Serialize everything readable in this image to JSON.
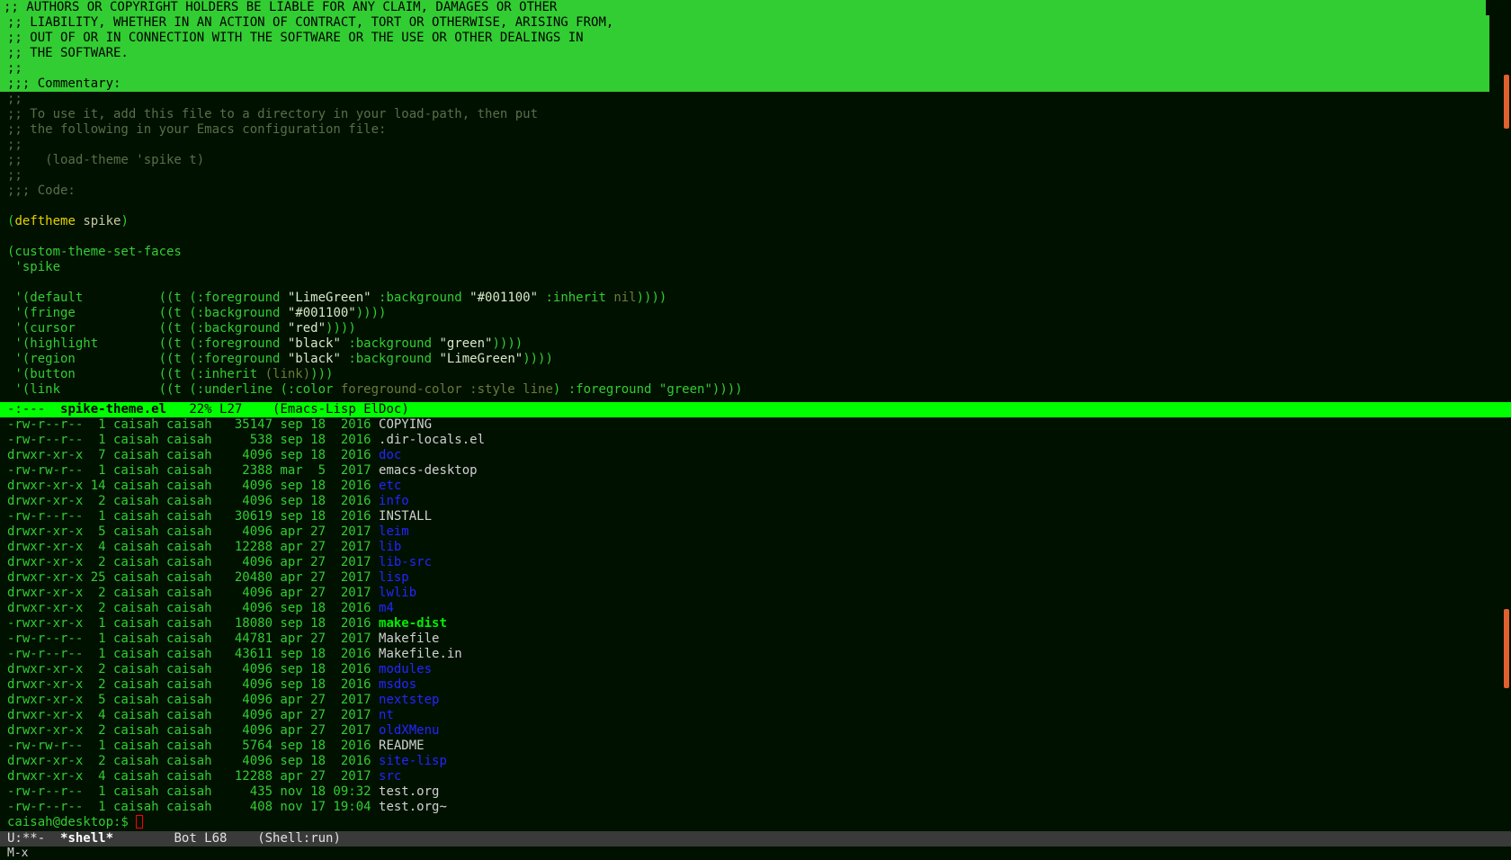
{
  "editor": {
    "highlighted_lines": [
      ";; AUTHORS OR COPYRIGHT HOLDERS BE LIABLE FOR ANY CLAIM, DAMAGES OR OTHER",
      ";; LIABILITY, WHETHER IN AN ACTION OF CONTRACT, TORT OR OTHERWISE, ARISING FROM,",
      ";; OUT OF OR IN CONNECTION WITH THE SOFTWARE OR THE USE OR OTHER DEALINGS IN",
      ";; THE SOFTWARE.",
      ";;",
      ";;; Commentary:"
    ],
    "comment_lines": [
      ";;",
      ";; To use it, add this file to a directory in your load-path, then put",
      ";; the following in your Emacs configuration file:",
      ";;",
      ";;   (load-theme 'spike t)",
      ";;",
      ";;; Code:"
    ],
    "deftheme": {
      "open": "(",
      "keyword": "deftheme",
      "name": "spike",
      "close": ")"
    },
    "custom_faces": "(custom-theme-set-faces",
    "theme_quote": " 'spike",
    "face_lines": [
      {
        "face": " '(default          ",
        "spec_pre": "((t (:foreground ",
        "s1": "\"LimeGreen\"",
        "mid": " :background ",
        "s2": "\"#001100\"",
        "tail_pre": " :inherit ",
        "tail_dim": "nil",
        "end": "))))"
      },
      {
        "face": " '(fringe           ",
        "spec_pre": "((t (:background ",
        "s1": "\"#001100\"",
        "mid": "",
        "s2": "",
        "tail_pre": "",
        "tail_dim": "",
        "end": "))))"
      },
      {
        "face": " '(cursor           ",
        "spec_pre": "((t (:background ",
        "s1": "\"red\"",
        "mid": "",
        "s2": "",
        "tail_pre": "",
        "tail_dim": "",
        "end": "))))"
      },
      {
        "face": " '(highlight        ",
        "spec_pre": "((t (:foreground ",
        "s1": "\"black\"",
        "mid": " :background ",
        "s2": "\"green\"",
        "tail_pre": "",
        "tail_dim": "",
        "end": "))))"
      },
      {
        "face": " '(region           ",
        "spec_pre": "((t (:foreground ",
        "s1": "\"black\"",
        "mid": " :background ",
        "s2": "\"LimeGreen\"",
        "tail_pre": "",
        "tail_dim": "",
        "end": "))))"
      },
      {
        "face": " '(button           ",
        "spec_pre": "((t (:inherit ",
        "s1": "",
        "mid": "",
        "s2": "",
        "tail_pre": "",
        "tail_dim": "(link)",
        "end": ")))"
      },
      {
        "face": " '(link             ",
        "spec_pre": "((t (:underline (:color ",
        "s1": "",
        "mid": "",
        "s2": "",
        "tail_pre": "",
        "tail_dim": "foreground-color :style line",
        "end": ") :foreground \"green\"))))"
      }
    ]
  },
  "top_modeline": {
    "status": "-:---  ",
    "buffer": "spike-theme.el",
    "position": "   22% L27    ",
    "modes": "(Emacs-Lisp ElDoc)"
  },
  "shell": {
    "rows": [
      {
        "perm": "-rw-r--r--  1 caisah caisah   35147 sep 18  2016 ",
        "name": "COPYING",
        "kind": "file"
      },
      {
        "perm": "-rw-r--r--  1 caisah caisah     538 sep 18  2016 ",
        "name": ".dir-locals.el",
        "kind": "file"
      },
      {
        "perm": "drwxr-xr-x  7 caisah caisah    4096 sep 18  2016 ",
        "name": "doc",
        "kind": "dir"
      },
      {
        "perm": "-rw-rw-r--  1 caisah caisah    2388 mar  5  2017 ",
        "name": "emacs-desktop",
        "kind": "file"
      },
      {
        "perm": "drwxr-xr-x 14 caisah caisah    4096 sep 18  2016 ",
        "name": "etc",
        "kind": "dir"
      },
      {
        "perm": "drwxr-xr-x  2 caisah caisah    4096 sep 18  2016 ",
        "name": "info",
        "kind": "dir"
      },
      {
        "perm": "-rw-r--r--  1 caisah caisah   30619 sep 18  2016 ",
        "name": "INSTALL",
        "kind": "file"
      },
      {
        "perm": "drwxr-xr-x  5 caisah caisah    4096 apr 27  2017 ",
        "name": "leim",
        "kind": "dir"
      },
      {
        "perm": "drwxr-xr-x  4 caisah caisah   12288 apr 27  2017 ",
        "name": "lib",
        "kind": "dir"
      },
      {
        "perm": "drwxr-xr-x  2 caisah caisah    4096 apr 27  2017 ",
        "name": "lib-src",
        "kind": "dir"
      },
      {
        "perm": "drwxr-xr-x 25 caisah caisah   20480 apr 27  2017 ",
        "name": "lisp",
        "kind": "dir"
      },
      {
        "perm": "drwxr-xr-x  2 caisah caisah    4096 apr 27  2017 ",
        "name": "lwlib",
        "kind": "dir"
      },
      {
        "perm": "drwxr-xr-x  2 caisah caisah    4096 sep 18  2016 ",
        "name": "m4",
        "kind": "dir"
      },
      {
        "perm": "-rwxr-xr-x  1 caisah caisah   18080 sep 18  2016 ",
        "name": "make-dist",
        "kind": "exe"
      },
      {
        "perm": "-rw-r--r--  1 caisah caisah   44781 apr 27  2017 ",
        "name": "Makefile",
        "kind": "file"
      },
      {
        "perm": "-rw-r--r--  1 caisah caisah   43611 sep 18  2016 ",
        "name": "Makefile.in",
        "kind": "file"
      },
      {
        "perm": "drwxr-xr-x  2 caisah caisah    4096 sep 18  2016 ",
        "name": "modules",
        "kind": "dir"
      },
      {
        "perm": "drwxr-xr-x  2 caisah caisah    4096 sep 18  2016 ",
        "name": "msdos",
        "kind": "dir"
      },
      {
        "perm": "drwxr-xr-x  5 caisah caisah    4096 apr 27  2017 ",
        "name": "nextstep",
        "kind": "dir"
      },
      {
        "perm": "drwxr-xr-x  4 caisah caisah    4096 apr 27  2017 ",
        "name": "nt",
        "kind": "dir"
      },
      {
        "perm": "drwxr-xr-x  2 caisah caisah    4096 apr 27  2017 ",
        "name": "oldXMenu",
        "kind": "dir"
      },
      {
        "perm": "-rw-rw-r--  1 caisah caisah    5764 sep 18  2016 ",
        "name": "README",
        "kind": "file"
      },
      {
        "perm": "drwxr-xr-x  2 caisah caisah    4096 sep 18  2016 ",
        "name": "site-lisp",
        "kind": "dir"
      },
      {
        "perm": "drwxr-xr-x  4 caisah caisah   12288 apr 27  2017 ",
        "name": "src",
        "kind": "dir"
      },
      {
        "perm": "-rw-r--r--  1 caisah caisah     435 nov 18 09:32 ",
        "name": "test.org",
        "kind": "file"
      },
      {
        "perm": "-rw-r--r--  1 caisah caisah     408 nov 17 19:04 ",
        "name": "test.org~",
        "kind": "file"
      }
    ],
    "prompt": "caisah@desktop:$ "
  },
  "bottom_modeline": {
    "status": "U:**-  ",
    "buffer": "*shell*",
    "position": "        Bot L68    ",
    "modes": "(Shell:run)"
  },
  "echo_area": {
    "text": "M-x"
  },
  "colors": {
    "background": "#001100",
    "foreground": "#32cd32",
    "directory": "#2525ff",
    "cursor": "#ff0000",
    "active_modeline": "#00ff00"
  }
}
